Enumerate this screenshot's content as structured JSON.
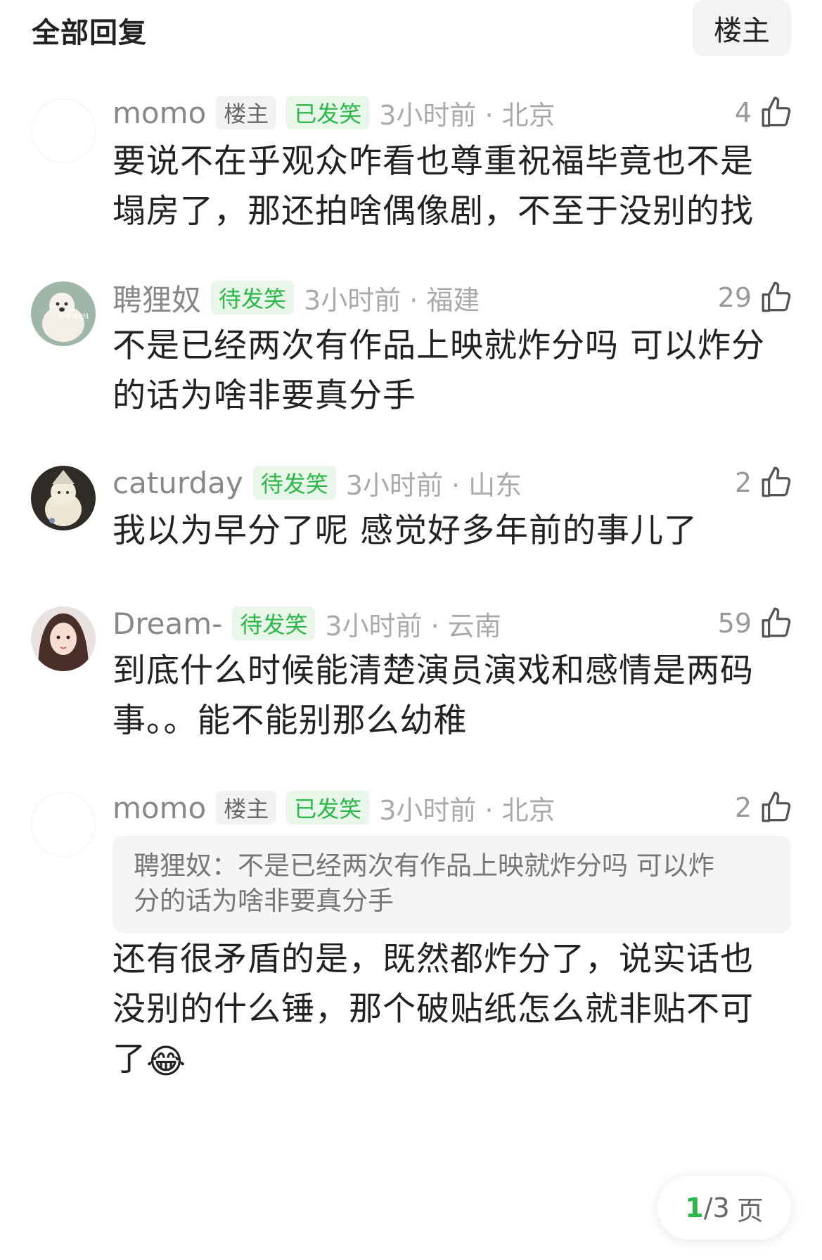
{
  "header": {
    "title": "全部回复",
    "filter_label": "楼主"
  },
  "comments": [
    {
      "username": "momo",
      "badges": [
        "楼主",
        "已发笑"
      ],
      "time_location": "3小时前 · 北京",
      "likes": "4",
      "lines": [
        "要说不在乎观众咋看也尊重祝福毕竟也不是",
        "塌房了，那还拍啥偶像剧，不至于没别的找"
      ]
    },
    {
      "username": "聘狸奴",
      "badges": [
        "待发笑"
      ],
      "time_location": "3小时前 · 福建",
      "likes": "29",
      "avatar_caption": "哼哈 嘿张吼",
      "lines": [
        "不是已经两次有作品上映就炸分吗 可以炸分",
        "的话为啥非要真分手"
      ]
    },
    {
      "username": "caturday",
      "badges": [
        "待发笑"
      ],
      "time_location": "3小时前 · 山东",
      "likes": "2",
      "lines": [
        "我以为早分了呢 感觉好多年前的事儿了"
      ]
    },
    {
      "username": "Dream-",
      "badges": [
        "待发笑"
      ],
      "time_location": "3小时前 · 云南",
      "likes": "59",
      "lines": [
        "到底什么时候能清楚演员演戏和感情是两码",
        "事。。能不能别那么幼稚"
      ]
    },
    {
      "username": "momo",
      "badges": [
        "楼主",
        "已发笑"
      ],
      "time_location": "3小时前 · 北京",
      "likes": "2",
      "quote": [
        "聘狸奴：不是已经两次有作品上映就炸分吗 可以炸",
        "分的话为啥非要真分手"
      ],
      "lines": [
        "还有很矛盾的是，既然都炸分了，说实话也",
        "没别的什么锤，那个破贴纸怎么就非贴不可",
        "了"
      ],
      "emoji": "😂"
    }
  ],
  "pager": {
    "current": "1",
    "separator": "/",
    "total": "3",
    "unit": "页"
  },
  "colors": {
    "accent_green": "#2db84a",
    "badge_green_bg": "#e9f7ea",
    "meta_gray": "#aaaaaa"
  },
  "icons": {
    "like": "thumbs-up-icon",
    "emoji": "laughing-tears-emoji"
  }
}
